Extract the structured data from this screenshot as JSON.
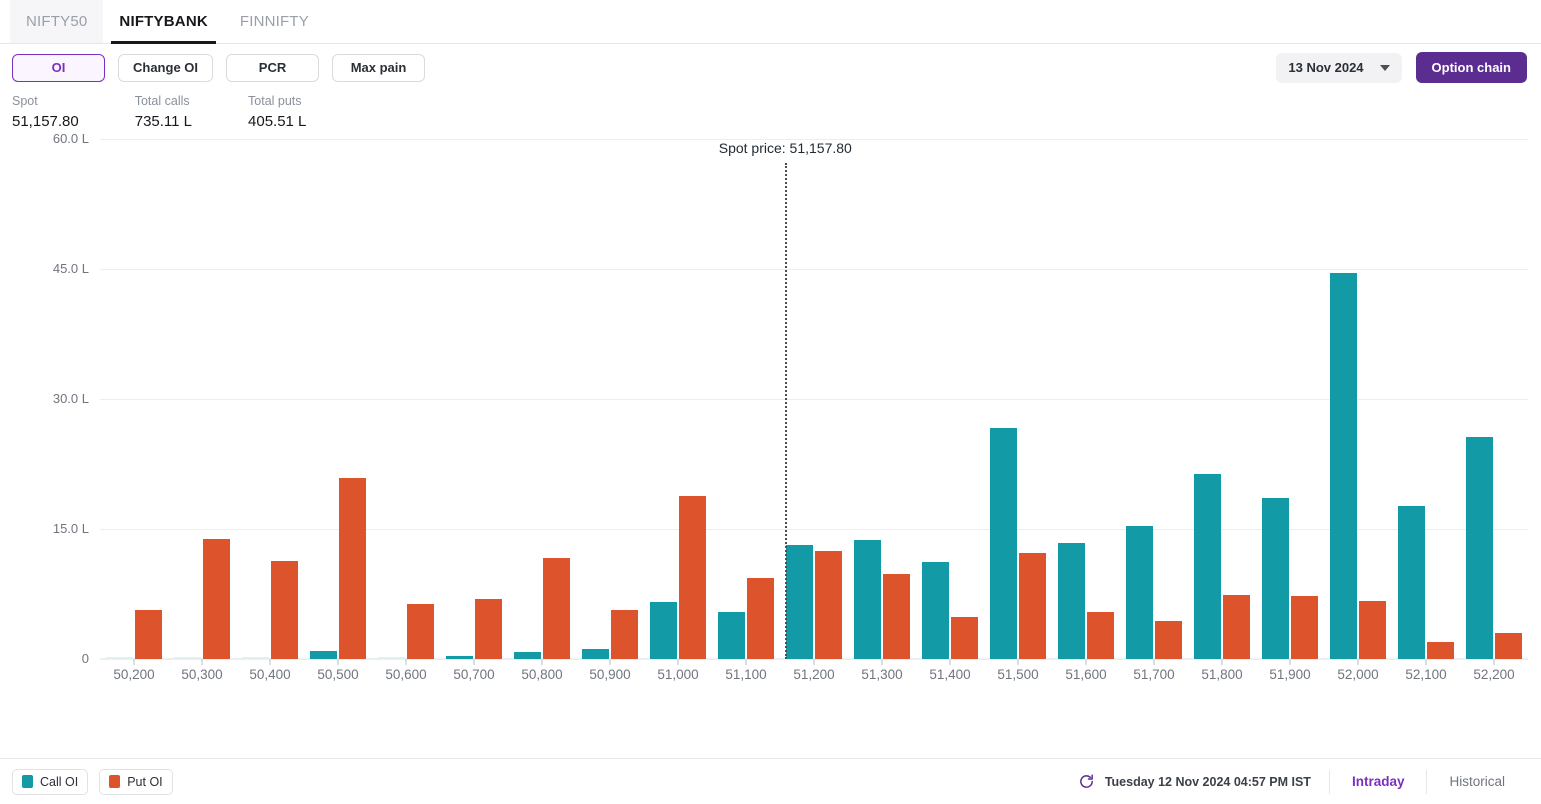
{
  "index_tabs": [
    {
      "label": "NIFTY50",
      "active": false,
      "hover": true
    },
    {
      "label": "NIFTYBANK",
      "active": true,
      "hover": false
    },
    {
      "label": "FINNIFTY",
      "active": false,
      "hover": false
    }
  ],
  "metric_buttons": [
    {
      "label": "OI",
      "selected": true
    },
    {
      "label": "Change OI",
      "selected": false
    },
    {
      "label": "PCR",
      "selected": false
    },
    {
      "label": "Max pain",
      "selected": false
    }
  ],
  "expiry": {
    "value": "13 Nov 2024",
    "icon": "chevron-down-icon"
  },
  "option_chain_button": {
    "label": "Option chain"
  },
  "stats": [
    {
      "label": "Spot",
      "value": "51,157.80"
    },
    {
      "label": "Total calls",
      "value": "735.11 L"
    },
    {
      "label": "Total puts",
      "value": "405.51 L"
    }
  ],
  "spot_marker": {
    "label": "Spot price: 51,157.80",
    "strike": 51157.8
  },
  "legend": [
    {
      "label": "Call OI",
      "color": "#129aa6"
    },
    {
      "label": "Put OI",
      "color": "#dd532b"
    }
  ],
  "footer": {
    "refresh_icon": "refresh-icon",
    "timestamp": "Tuesday 12 Nov 2024 04:57 PM IST",
    "ranges": [
      {
        "label": "Intraday",
        "active": true
      },
      {
        "label": "Historical",
        "active": false
      }
    ]
  },
  "colors": {
    "call": "#129aa6",
    "put": "#dd532b",
    "accent_purple": "#7b2fbe",
    "brand_purple": "#5c2d91",
    "grid": "#eceef0",
    "axis_text": "#70757e"
  },
  "chart_data": {
    "type": "bar",
    "title": "",
    "xlabel": "",
    "ylabel": "",
    "ylim": [
      0,
      60
    ],
    "yticks": [
      0,
      15,
      30,
      45,
      60
    ],
    "ytick_labels": [
      "0",
      "15.0 L",
      "30.0 L",
      "45.0 L",
      "60.0 L"
    ],
    "unit": "L",
    "grid": true,
    "legend_position": "bottom-left",
    "categories": [
      "50,200",
      "50,300",
      "50,400",
      "50,500",
      "50,600",
      "50,700",
      "50,800",
      "50,900",
      "51,000",
      "51,100",
      "51,200",
      "51,300",
      "51,400",
      "51,500",
      "51,600",
      "51,700",
      "51,800",
      "51,900",
      "52,000",
      "52,100",
      "52,200"
    ],
    "series": [
      {
        "name": "Call OI",
        "color": "#129aa6",
        "values": [
          0.1,
          0.12,
          0.15,
          0.9,
          0.2,
          0.3,
          0.8,
          1.2,
          6.6,
          5.4,
          13.2,
          13.7,
          11.2,
          26.6,
          13.4,
          15.3,
          21.4,
          18.6,
          44.5,
          17.6,
          25.6
        ]
      },
      {
        "name": "Put OI",
        "color": "#dd532b",
        "values": [
          5.6,
          13.9,
          11.3,
          20.9,
          6.4,
          6.9,
          11.6,
          5.6,
          18.8,
          9.3,
          12.5,
          9.8,
          4.8,
          12.2,
          5.4,
          4.4,
          7.4,
          7.3,
          6.7,
          2.0,
          3.0
        ]
      }
    ]
  }
}
